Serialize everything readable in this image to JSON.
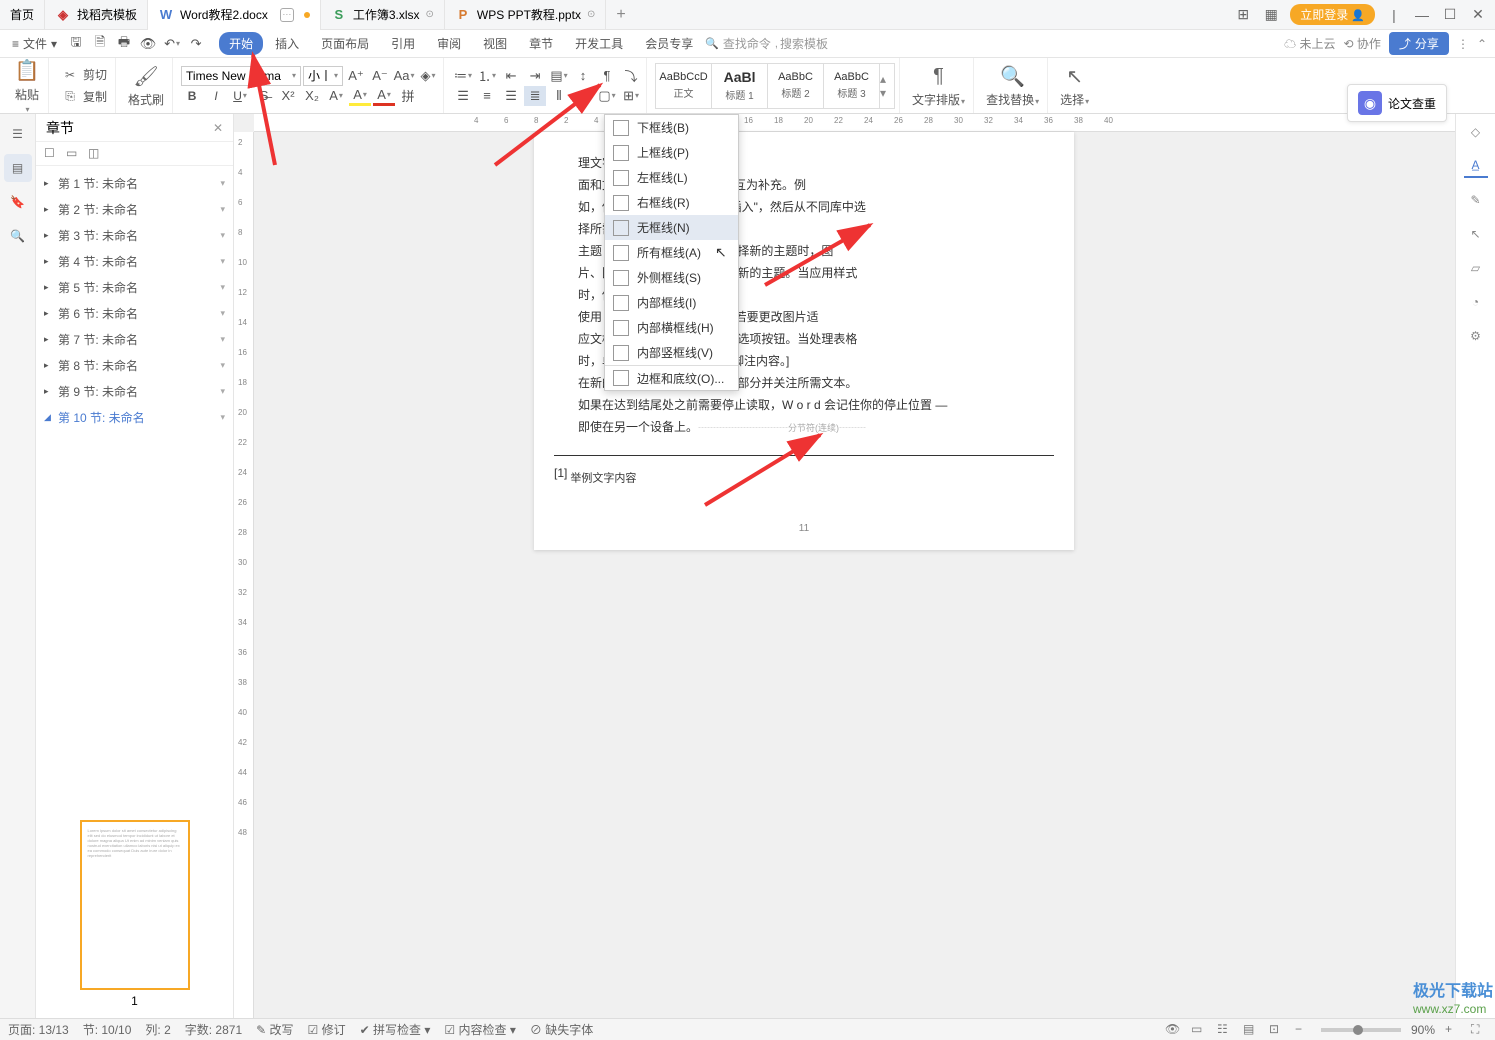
{
  "tabs": {
    "home": "首页",
    "items": [
      {
        "icon": "d",
        "label": "找稻壳模板"
      },
      {
        "icon": "w",
        "label": "Word教程2.docx",
        "active": true
      },
      {
        "icon": "s",
        "label": "工作簿3.xlsx"
      },
      {
        "icon": "p",
        "label": "WPS PPT教程.pptx"
      }
    ]
  },
  "win": {
    "login": "立即登录"
  },
  "file": {
    "label": "文件"
  },
  "menus": [
    "开始",
    "插入",
    "页面布局",
    "引用",
    "审阅",
    "视图",
    "章节",
    "开发工具",
    "会员专享"
  ],
  "menu_active": 0,
  "search": {
    "cmd": "查找命令",
    "tpl": "搜索模板"
  },
  "topright": {
    "cloud": "未上云",
    "collab": "协作",
    "share": "分享"
  },
  "ribbon": {
    "paste": "粘贴",
    "cut": "剪切",
    "copy": "复制",
    "fmtpaint": "格式刷",
    "font": "Times New Roma",
    "size": "小丨",
    "typeset": "文字排版",
    "find": "查找替换",
    "select": "选择",
    "styles": [
      {
        "prev": "AaBbCcD",
        "lbl": "正文"
      },
      {
        "prev": "AaBl",
        "lbl": "标题 1",
        "bold": true
      },
      {
        "prev": "AaBbC",
        "lbl": "标题 2"
      },
      {
        "prev": "AaBbC",
        "lbl": "标题 3"
      }
    ]
  },
  "nav": {
    "title": "章节",
    "items": [
      "第 1 节: 未命名",
      "第 2 节: 未命名",
      "第 3 节: 未命名",
      "第 4 节: 未命名",
      "第 5 节: 未命名",
      "第 6 节: 未命名",
      "第 7 节: 未命名",
      "第 8 节: 未命名",
      "第 9 节: 未命名",
      "第 10 节: 未命名"
    ],
    "selected": 9,
    "thumb_num": "1"
  },
  "ruler_h": [
    4,
    6,
    8,
    2,
    4,
    6,
    10,
    12,
    14,
    16,
    18,
    20,
    22,
    24,
    26,
    28,
    30,
    32,
    34,
    36,
    38,
    40
  ],
  "ruler_v": [
    2,
    4,
    6,
    8,
    10,
    12,
    14,
    16,
    18,
    20,
    22,
    24,
    26,
    28,
    30,
    32,
    34,
    36,
    38,
    40,
    42,
    44,
    46,
    48
  ],
  "doc": {
    "lines": [
      "理文字。】",
      "面和文本框设计，这些设计可互为补充。例",
      "如，你可以                                       和提要栏。单击\"插入\"，然后从不同库中选",
      "择所需元",
      "主题                                          协调。当你单击设计并选择新的主题时，图",
      "片、图表                                        图形将会更改以匹配新的主题。当应用样式",
      "时，你的                                        的主题。",
      "使用                                         在 W o r d 中保存时间。若要更改图片适",
      "应文档的                                        片旁边将会显示布局选项按钮。当处理表格",
      "时，单击                                        后单击加号。[ 举例脚注内容。]",
      "在新的                                        易。可以折叠文档某些部分并关注所需文本。",
      "如果在达到结尾处之前需要停止读取，W o r d  会记住你的停止位置  —  ",
      "即使在另一个设备上。"
    ],
    "section_break": "分节符(连续)",
    "footnote_mark": "[1]",
    "footnote": "举例文字内容",
    "pagenum": "11"
  },
  "border_menu": [
    {
      "label": "下框线(B)",
      "key": "bottom"
    },
    {
      "label": "上框线(P)",
      "key": "top"
    },
    {
      "label": "左框线(L)",
      "key": "left"
    },
    {
      "label": "右框线(R)",
      "key": "right"
    },
    {
      "label": "无框线(N)",
      "key": "none",
      "hover": true
    },
    {
      "label": "所有框线(A)",
      "key": "all"
    },
    {
      "label": "外侧框线(S)",
      "key": "outside"
    },
    {
      "label": "内部框线(I)",
      "key": "inside"
    },
    {
      "label": "内部横框线(H)",
      "key": "h"
    },
    {
      "label": "内部竖框线(V)",
      "key": "v"
    },
    {
      "label": "边框和底纹(O)...",
      "key": "dlg",
      "sep": true
    }
  ],
  "paper_check": "论文查重",
  "status": {
    "page": "页面: 13/13",
    "section": "节: 10/10",
    "col": "列: 2",
    "words": "字数: 2871",
    "cn": "改写",
    "rev": "修订",
    "spell": "拼写检查",
    "content": "内容检查",
    "font": "缺失字体",
    "zoom": "90%"
  },
  "watermark": {
    "l1": "极光下载站",
    "l2": "www.xz7.com"
  }
}
